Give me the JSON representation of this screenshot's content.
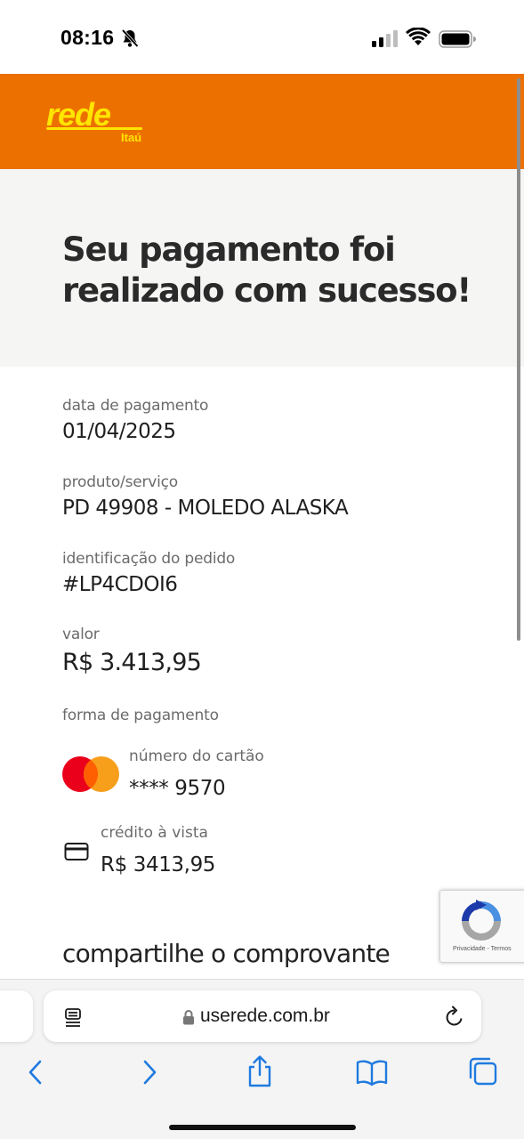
{
  "status_bar": {
    "time": "08:16",
    "icons": [
      "bell-slash-icon",
      "cellular-signal-icon",
      "wifi-icon",
      "battery-icon"
    ]
  },
  "brand": {
    "logo_text": "rede",
    "logo_sub": "Itaú",
    "color": "#ec7000",
    "logo_color": "#ffe500"
  },
  "hero": {
    "title": "Seu pagamento foi realizado com sucesso!"
  },
  "details": {
    "payment_date": {
      "label": "data de pagamento",
      "value": "01/04/2025"
    },
    "product": {
      "label": "produto/serviço",
      "value": "PD 49908 - MOLEDO ALASKA"
    },
    "order_id": {
      "label": "identificação do pedido",
      "value": "#LP4CDOI6"
    },
    "amount": {
      "label": "valor",
      "value": "R$ 3.413,95"
    },
    "payment_method": {
      "label": "forma de pagamento"
    },
    "card": {
      "brand_icon": "mastercard-icon",
      "label": "número do cartão",
      "value": "**** 9570"
    },
    "credit": {
      "icon": "credit-card-icon",
      "label": "crédito à vista",
      "value": "R$ 3413,95"
    }
  },
  "share": {
    "title": "compartilhe o comprovante"
  },
  "recaptcha": {
    "links": "Privacidade - Termos"
  },
  "browser": {
    "url": "userede.com.br",
    "toolbar": [
      "back-icon",
      "forward-icon",
      "share-icon",
      "bookmarks-icon",
      "tabs-icon"
    ]
  }
}
